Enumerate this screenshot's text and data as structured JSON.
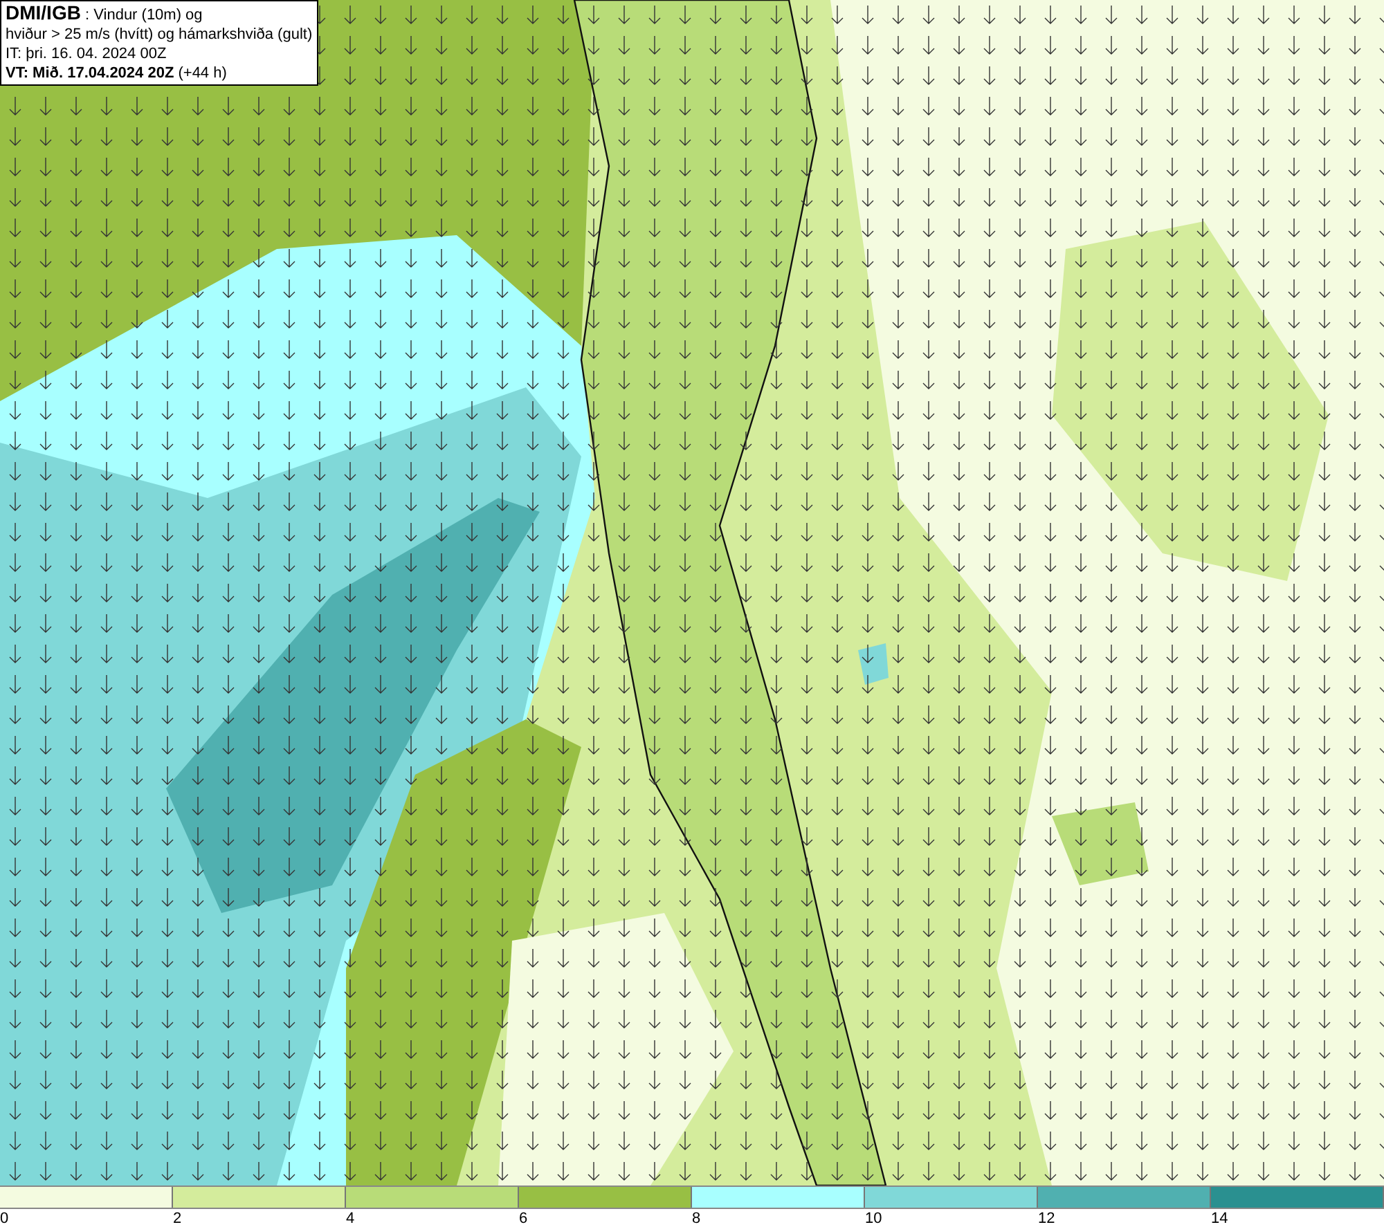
{
  "header": {
    "lines": [
      "**DMI/IGB** : Vindur (10m) og",
      "hviður > 25 m/s (hvítt) og hámarkshviða (gult)",
      "IT: þri. 16. 04. 2024 00Z",
      "**VT: Mið. 17.04.2024 20Z** (+44 h)"
    ]
  },
  "legend": {
    "segments": [
      {
        "color": "#f4fbe0"
      },
      {
        "color": "#d4ec9c"
      },
      {
        "color": "#b8dc78"
      },
      {
        "color": "#98bf44"
      },
      {
        "color": "#a8ffff"
      },
      {
        "color": "#80d8d8"
      },
      {
        "color": "#50b0b0"
      },
      {
        "color": "#2a9090"
      }
    ],
    "ticks": [
      "0",
      "2",
      "4",
      "6",
      "8",
      "10",
      "12",
      "14"
    ]
  }
}
